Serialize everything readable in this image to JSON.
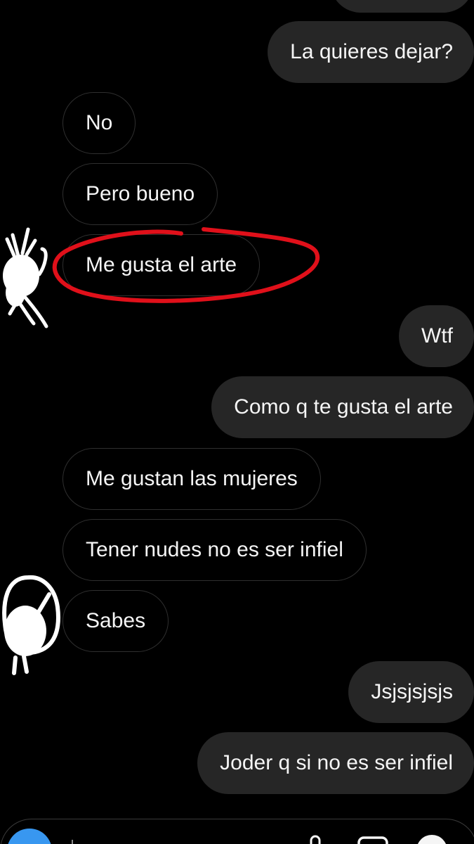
{
  "conversation": {
    "messages": [
      {
        "id": 1,
        "direction": "sent",
        "text": "La quieres dejar?"
      },
      {
        "id": 2,
        "direction": "received",
        "text": "No"
      },
      {
        "id": 3,
        "direction": "received",
        "text": "Pero bueno"
      },
      {
        "id": 4,
        "direction": "received",
        "text": "Me gusta el arte",
        "annotation": "circled-in-red"
      },
      {
        "id": 5,
        "direction": "sent",
        "text": "Wtf"
      },
      {
        "id": 6,
        "direction": "sent",
        "text": "Como q te gusta el arte"
      },
      {
        "id": 7,
        "direction": "received",
        "text": "Me gustan las mujeres"
      },
      {
        "id": 8,
        "direction": "received",
        "text": "Tener nudes no es ser infiel"
      },
      {
        "id": 9,
        "direction": "received",
        "text": "Sabes"
      },
      {
        "id": 10,
        "direction": "sent",
        "text": "Jsjsjsjsjs"
      },
      {
        "id": 11,
        "direction": "sent",
        "text": "Joder q si no es ser infiel"
      }
    ]
  },
  "composer": {
    "icons": [
      "camera-icon",
      "microphone-icon",
      "gallery-icon",
      "sticker-icon"
    ]
  },
  "colors": {
    "background": "#000000",
    "sent_bubble": "#262626",
    "received_border": "#2f2f2f",
    "text": "#f5f5f5",
    "annotation_red": "#e0101a",
    "scribble_white": "#ffffff",
    "camera_button": "#3897f0"
  }
}
